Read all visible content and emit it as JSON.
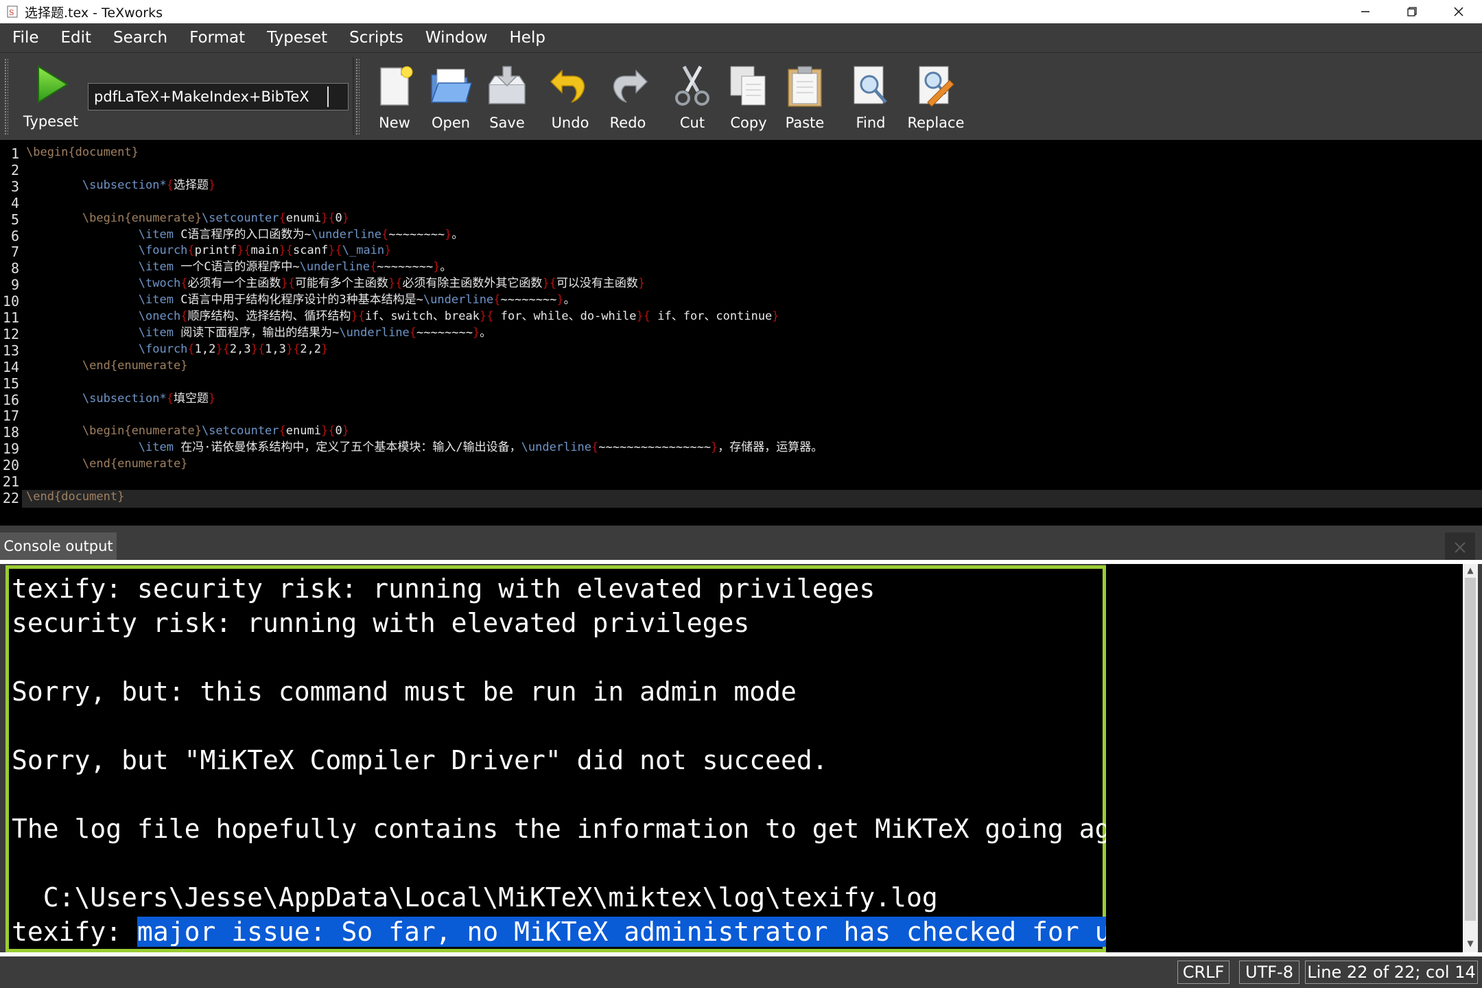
{
  "window": {
    "title": "选择题.tex - TeXworks",
    "controls": [
      "minimize",
      "restore",
      "close"
    ]
  },
  "menu": [
    "File",
    "Edit",
    "Search",
    "Format",
    "Typeset",
    "Scripts",
    "Window",
    "Help"
  ],
  "toolbar": {
    "typeset_label": "Typeset",
    "engine": "pdfLaTeX+MakeIndex+BibTeX",
    "buttons": [
      {
        "label": "New",
        "icon": "new-file-icon"
      },
      {
        "label": "Open",
        "icon": "open-folder-icon"
      },
      {
        "label": "Save",
        "icon": "save-icon"
      },
      {
        "label": "Undo",
        "icon": "undo-icon"
      },
      {
        "label": "Redo",
        "icon": "redo-icon"
      },
      {
        "label": "Cut",
        "icon": "scissors-icon"
      },
      {
        "label": "Copy",
        "icon": "copy-icon"
      },
      {
        "label": "Paste",
        "icon": "clipboard-icon"
      },
      {
        "label": "Find",
        "icon": "find-icon"
      },
      {
        "label": "Replace",
        "icon": "replace-icon"
      }
    ]
  },
  "editor": {
    "line_numbers": [
      "1",
      "2",
      "3",
      "4",
      "5",
      "6",
      "7",
      "8",
      "9",
      "10",
      "11",
      "12",
      "13",
      "14",
      "15",
      "16",
      "17",
      "18",
      "19",
      "20",
      "21",
      "22"
    ],
    "lines": [
      "\\begin{document}",
      "",
      "        \\subsection*{选择题}",
      "",
      "        \\begin{enumerate}\\setcounter{enumi}{0}",
      "                \\item C语言程序的入口函数为~\\underline{~~~~~~~~}。",
      "                \\fourch{printf}{main}{scanf}{\\_main}",
      "                \\item 一个C语言的源程序中~\\underline{~~~~~~~~}。",
      "                \\twoch{必须有一个主函数}{可能有多个主函数}{必须有除主函数外其它函数}{可以没有主函数}",
      "                \\item C语言中用于结构化程序设计的3种基本结构是~\\underline{~~~~~~~~}。",
      "                \\onech{顺序结构、选择结构、循环结构}{if、switch、break}{ for、while、do-while}{ if、for、continue}",
      "                \\item 阅读下面程序，输出的结果为~\\underline{~~~~~~~~}。",
      "                \\fourch{1,2}{2,3}{1,3}{2,2}",
      "        \\end{enumerate}",
      "",
      "        \\subsection*{填空题}",
      "",
      "        \\begin{enumerate}\\setcounter{enumi}{0}",
      "                \\item 在冯·诺依曼体系结构中，定义了五个基本模块：输入/输出设备，\\underline{~~~~~~~~~~~~~~~~}，存储器，运算器。",
      "        \\end{enumerate}",
      "",
      "\\end{document}"
    ]
  },
  "console": {
    "tab_label": "Console output",
    "lines": [
      "texify: security risk: running with elevated privileges",
      "security risk: running with elevated privileges",
      "",
      "Sorry, but: this command must be run in admin mode",
      "",
      "Sorry, but \"MiKTeX Compiler Driver\" did not succeed.",
      "",
      "The log file hopefully contains the information to get MiKTeX going again:",
      "",
      "  C:\\Users\\Jesse\\AppData\\Local\\MiKTeX\\miktex\\log\\texify.log"
    ],
    "last_line_prefix": "texify: ",
    "last_line_selected": "major issue: So far, no MiKTeX administrator has checked for updates",
    "last_line_suffix": "."
  },
  "status": {
    "line_ending": "CRLF",
    "encoding": "UTF-8",
    "position": "Line 22 of 22; col 14"
  },
  "colors": {
    "console_border": "#9acd32",
    "selection": "#0a5bd6",
    "keyword": "#6f95c8",
    "brace": "#b01010"
  }
}
